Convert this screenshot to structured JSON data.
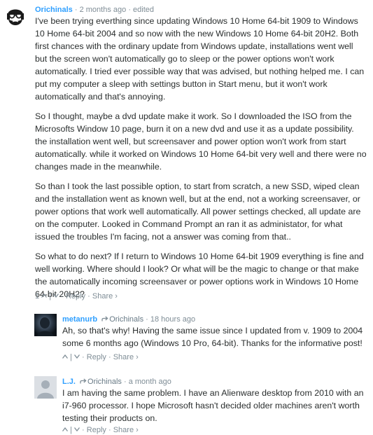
{
  "comments": [
    {
      "author": "Orichinals",
      "time": "2 months ago",
      "edited": "edited",
      "paragraphs": [
        "I've been trying everthing since updating Windows 10 Home 64-bit 1909 to Windows 10 Home 64-bit 2004 and so now with the new Windows 10 Home 64-bit 20H2. Both first chances with the ordinary update from Windows update, installations went well but the screen won't automatically go to sleep or the power options won't work automatically. I tried ever possible way that was advised, but nothing helped me. I can put my computer a sleep with settings button in Start menu, but it won't work automatically and that's annoying.",
        "So I thought, maybe a dvd update make it work. So I downloaded the ISO from the Microsofts Window 10 page, burn it on a new dvd and use it as a update possibility. the installation went well, but screensaver and power option won't work from start automatically. while it worked on Windows 10 Home 64-bit very well and there were no changes made in the meanwhile.",
        "So than I took the last possible option, to start from scratch, a new SSD, wiped clean and the installation went as known well, but at the end, not a working screensaver, or power options that work well automatically. All power settings checked, all update are on the computer. Looked in Command Prompt an ran it as administator, for what issued the troubles I'm facing, not a answer was coming from that..",
        "So what to do next? If I return to Windows 10 Home 64-bit 1909 everything is fine and well working. Where should I look? Or what will be the magic to change or that make the automatically incoming screensaver or power options work in Windows 10 Home 64-bit 20H2?"
      ],
      "votes": "1",
      "reply": "Reply",
      "share": "Share ›"
    },
    {
      "author": "metanurb",
      "reply_to": "Orichinals",
      "time": "18 hours ago",
      "paragraphs": [
        "Ah, so that's why! Having the same issue since I updated from v. 1909 to 2004 some 6 months ago (Windows 10 Pro, 64-bit). Thanks for the informative post!"
      ],
      "reply": "Reply",
      "share": "Share ›"
    },
    {
      "author": "L.J.",
      "reply_to": "Orichinals",
      "time": "a month ago",
      "paragraphs": [
        "I am having the same problem. I have an Alienware desktop from 2010 with an i7-960 processor. I hope Microsoft hasn't decided older machines aren't worth testing their products on."
      ],
      "reply": "Reply",
      "share": "Share ›"
    }
  ],
  "separator": "·",
  "colors": {
    "author": "#2e9fff",
    "meta": "#7f8d96",
    "text": "#2a2e2e"
  }
}
